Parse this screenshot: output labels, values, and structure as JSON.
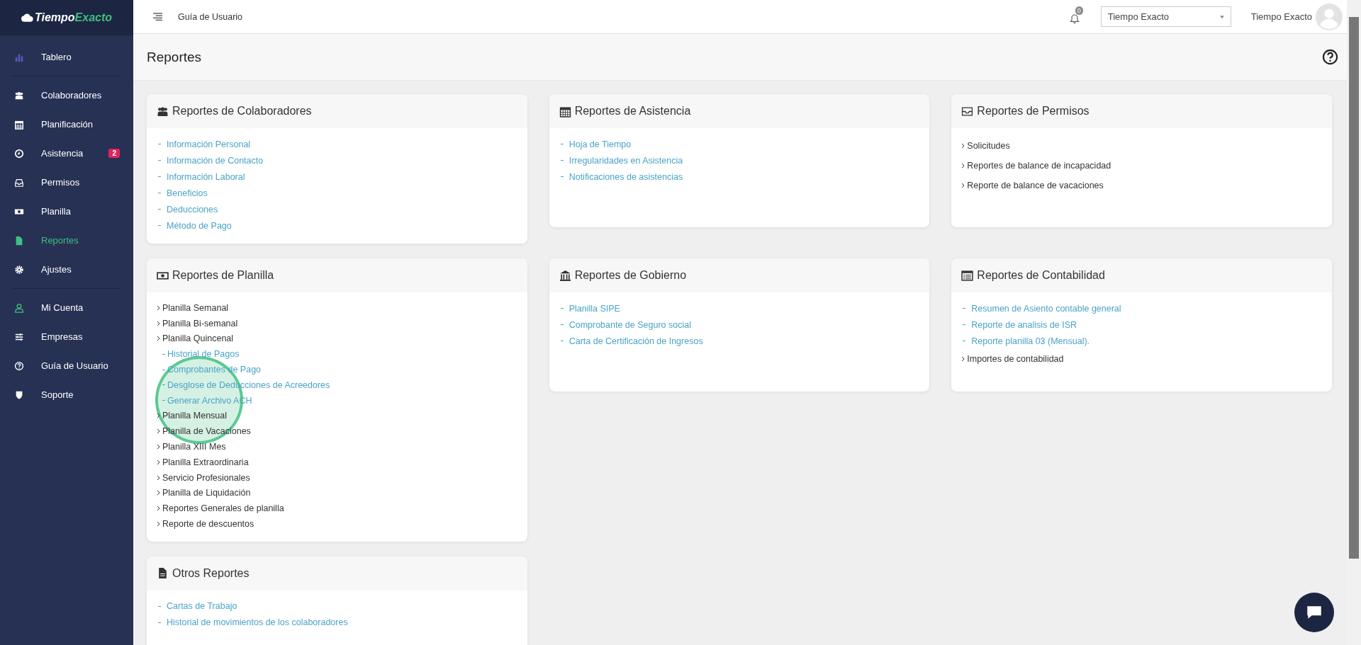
{
  "sidebar": {
    "logo": {
      "part_1": "Tiempo",
      "part_2": "Exacto"
    },
    "groups": [
      [
        {
          "label": "Tablero",
          "selected": false
        }
      ],
      [
        {
          "label": "Colaboradores",
          "selected": false
        },
        {
          "label": "Planificación",
          "selected": false
        },
        {
          "label": "Asistencia",
          "selected": false,
          "badge": "2"
        },
        {
          "label": "Permisos",
          "selected": false
        },
        {
          "label": "Planilla",
          "selected": false
        },
        {
          "label": "Reportes",
          "selected": true
        },
        {
          "label": "Ajustes",
          "selected": false
        }
      ],
      [
        {
          "label": "Mi Cuenta",
          "selected": false
        },
        {
          "label": "Empresas",
          "selected": false
        },
        {
          "label": "Guía de Usuario",
          "selected": false
        },
        {
          "label": "Soporte",
          "selected": false
        }
      ]
    ]
  },
  "topbar": {
    "guide_link": "Guía de Usuario",
    "notification_count": "0",
    "company_select": "Tiempo Exacto",
    "user_name": "Tiempo Exacto"
  },
  "page_title": "Reportes",
  "columns": [
    [
      {
        "title": "Reportes de Colaboradores",
        "items": [
          {
            "kind": "link",
            "label": "Información Personal"
          },
          {
            "kind": "link",
            "label": "Información de Contacto"
          },
          {
            "kind": "link",
            "label": "Información Laboral"
          },
          {
            "kind": "link",
            "label": "Beneficios"
          },
          {
            "kind": "link",
            "label": "Deducciones"
          },
          {
            "kind": "link",
            "label": "Método de Pago"
          }
        ]
      },
      {
        "title": "Reportes de Planilla",
        "items": [
          {
            "kind": "expander",
            "label": "Planilla Semanal"
          },
          {
            "kind": "expander",
            "label": "Planilla Bi-semanal"
          },
          {
            "kind": "expander",
            "label": "Planilla Quincenal"
          },
          {
            "kind": "sublink",
            "label": "Historial de Pagos"
          },
          {
            "kind": "sublink",
            "label": "Comprobantes de Pago"
          },
          {
            "kind": "sublink",
            "label": "Desglose de Deducciones de Acreedores"
          },
          {
            "kind": "sublink",
            "label": "Generar Archivo ACH"
          },
          {
            "kind": "expander",
            "label": "Planilla Mensual"
          },
          {
            "kind": "expander",
            "label": "Planilla de Vacaciones"
          },
          {
            "kind": "expander",
            "label": "Planilla XIII Mes"
          },
          {
            "kind": "expander",
            "label": "Planilla Extraordinaria"
          },
          {
            "kind": "expander",
            "label": "Servicio Profesionales"
          },
          {
            "kind": "expander",
            "label": "Planilla de Liquidación"
          },
          {
            "kind": "expander",
            "label": "Reportes Generales de planilla"
          },
          {
            "kind": "expander",
            "label": "Reporte de descuentos"
          }
        ]
      },
      {
        "title": "Otros Reportes",
        "items": [
          {
            "kind": "link",
            "label": "Cartas de Trabajo"
          },
          {
            "kind": "link",
            "label": "Historial de movimientos de los colaboradores"
          }
        ]
      }
    ],
    [
      {
        "title": "Reportes de Asistencia",
        "items": [
          {
            "kind": "link",
            "label": "Hoja de Tiempo"
          },
          {
            "kind": "link",
            "label": "Irregularidades en Asistencia"
          },
          {
            "kind": "link",
            "label": "Notificaciones de asistencias"
          }
        ]
      },
      {
        "title": "Reportes de Gobierno",
        "items": [
          {
            "kind": "link",
            "label": "Planilla SIPE"
          },
          {
            "kind": "link",
            "label": "Comprobante de Seguro social"
          },
          {
            "kind": "link",
            "label": "Carta de Certificación de Ingresos"
          }
        ]
      }
    ],
    [
      {
        "title": "Reportes de Permisos",
        "items": [
          {
            "kind": "expander",
            "label": "Solicitudes"
          },
          {
            "kind": "expander",
            "label": "Reportes de balance de incapacidad"
          },
          {
            "kind": "expander",
            "label": "Reporte de balance de vacaciones"
          }
        ]
      },
      {
        "title": "Reportes de Contabilidad",
        "items": [
          {
            "kind": "link",
            "label": "Resumen de Asiento contable general"
          },
          {
            "kind": "link",
            "label": "Reporte de analisis de ISR"
          },
          {
            "kind": "link",
            "label": "Reporte planilla 03 (Mensual)."
          },
          {
            "kind": "expander",
            "label": "Importes de contabilidad"
          }
        ]
      }
    ]
  ]
}
